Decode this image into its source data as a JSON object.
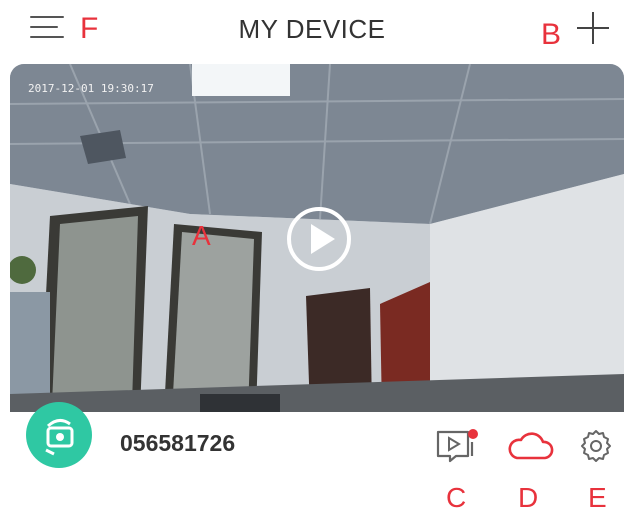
{
  "header": {
    "title": "MY DEVICE",
    "menu_label": "F",
    "add_label": "B"
  },
  "video": {
    "timestamp": "2017-12-01 19:30:17",
    "play_label": "A"
  },
  "device": {
    "id": "056581726"
  },
  "actions": [
    {
      "icon": "video-playback-icon",
      "label": "C"
    },
    {
      "icon": "cloud-icon",
      "label": "D"
    },
    {
      "icon": "gear-icon",
      "label": "E"
    }
  ],
  "colors": {
    "accent": "#e8323c",
    "avatar": "#2fc8a3",
    "notification_dot": "#e8323c"
  }
}
